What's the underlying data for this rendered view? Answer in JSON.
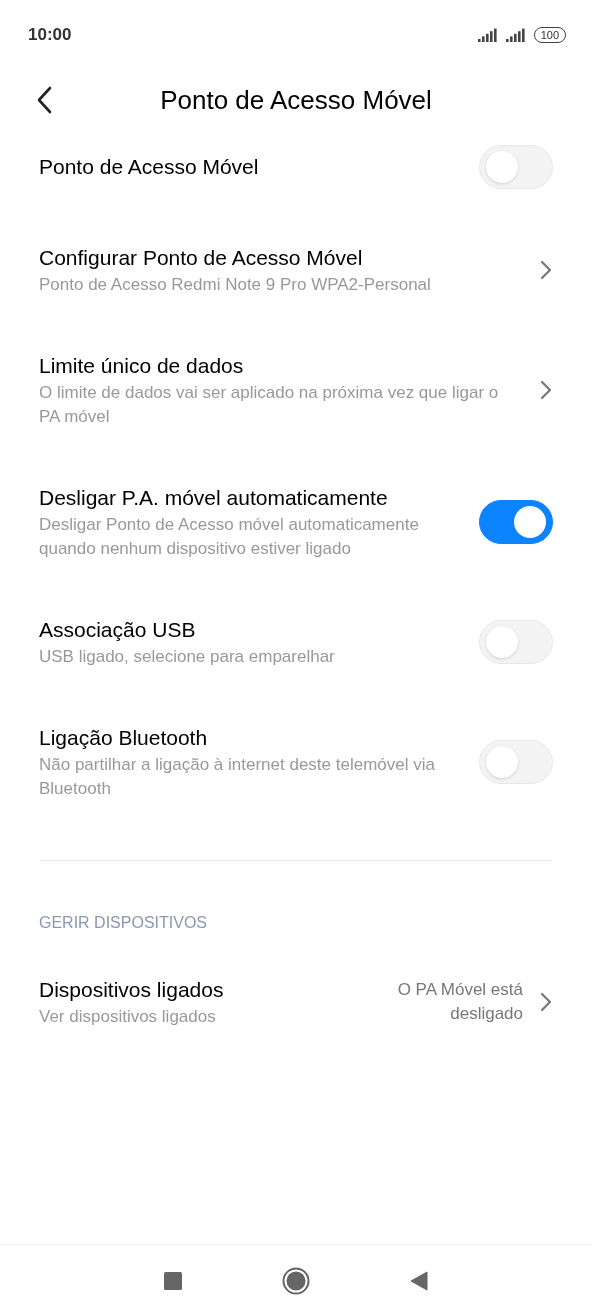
{
  "status_bar": {
    "time": "10:00",
    "battery": "100"
  },
  "header": {
    "title": "Ponto de Acesso Móvel"
  },
  "items": [
    {
      "kind": "toggle",
      "title": "Ponto de Acesso Móvel",
      "on": false
    },
    {
      "kind": "link",
      "title": "Configurar Ponto de Acesso Móvel",
      "subtitle": "Ponto de Acesso Redmi Note 9 Pro WPA2-Personal"
    },
    {
      "kind": "link",
      "title": "Limite único de dados",
      "subtitle": "O limite de dados vai ser aplicado na próxima vez que ligar o PA móvel"
    },
    {
      "kind": "toggle",
      "title": "Desligar P.A. móvel automaticamente",
      "subtitle": "Desligar Ponto de Acesso móvel automaticamente quando nenhum dispositivo estiver ligado",
      "on": true
    },
    {
      "kind": "toggle",
      "title": "Associação USB",
      "subtitle": "USB ligado, selecione para emparelhar",
      "on": false
    },
    {
      "kind": "toggle",
      "title": "Ligação Bluetooth",
      "subtitle": "Não partilhar a ligação à internet deste telemóvel via Bluetooth",
      "on": false
    }
  ],
  "section": {
    "heading": "GERIR DISPOSITIVOS",
    "items": [
      {
        "kind": "link",
        "title": "Dispositivos ligados",
        "subtitle": "Ver dispositivos ligados",
        "value": "O PA Móvel está desligado"
      }
    ]
  }
}
